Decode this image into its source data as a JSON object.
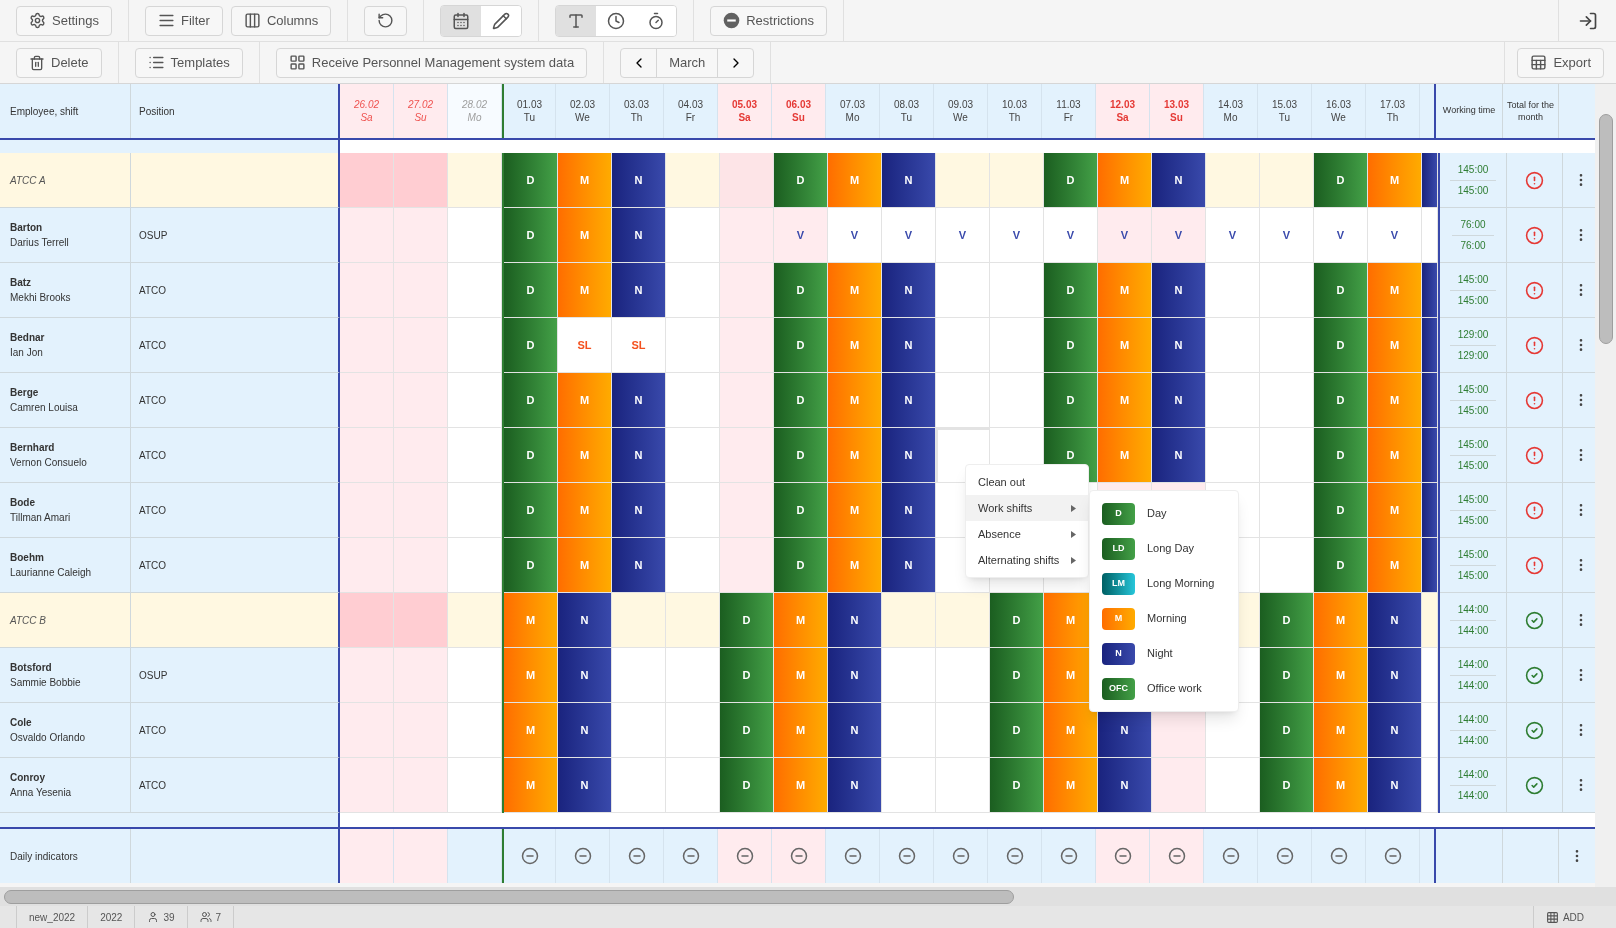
{
  "toolbar": {
    "buttons": [
      {
        "kind": "settings",
        "label": "Settings"
      },
      {
        "kind": "filter",
        "label": "Filter"
      },
      {
        "kind": "columns",
        "label": "Columns"
      },
      {
        "kind": "undo"
      }
    ],
    "view_toggle": [
      {
        "kind": "calendar",
        "selected": true
      },
      {
        "kind": "edit",
        "selected": false
      }
    ],
    "display_toggle": [
      {
        "kind": "text",
        "selected": true
      },
      {
        "kind": "clock",
        "selected": false
      },
      {
        "kind": "timer",
        "selected": false
      }
    ],
    "restrictions": "Restrictions"
  },
  "actions": {
    "delete": "Delete",
    "templates": "Templates",
    "receive": "Receive Personnel Management system data",
    "month": "March",
    "export": "Export"
  },
  "table": {
    "columns": {
      "employee": "Employee, shift",
      "position": "Position",
      "working_time": "Working time",
      "total": "Total for the month"
    },
    "days": [
      {
        "date": "26.02",
        "weekday": "Sa",
        "weekend": true,
        "previous_month": true
      },
      {
        "date": "27.02",
        "weekday": "Su",
        "weekend": true,
        "previous_month": true
      },
      {
        "date": "28.02",
        "weekday": "Mo",
        "weekend": false,
        "previous_month": true
      },
      {
        "date": "01.03",
        "weekday": "Tu",
        "weekend": false,
        "previous_month": false
      },
      {
        "date": "02.03",
        "weekday": "We",
        "weekend": false,
        "previous_month": false
      },
      {
        "date": "03.03",
        "weekday": "Th",
        "weekend": false,
        "previous_month": false
      },
      {
        "date": "04.03",
        "weekday": "Fr",
        "weekend": false,
        "previous_month": false
      },
      {
        "date": "05.03",
        "weekday": "Sa",
        "weekend": true,
        "previous_month": false
      },
      {
        "date": "06.03",
        "weekday": "Su",
        "weekend": true,
        "previous_month": false
      },
      {
        "date": "07.03",
        "weekday": "Mo",
        "weekend": false,
        "previous_month": false
      },
      {
        "date": "08.03",
        "weekday": "Tu",
        "weekend": false,
        "previous_month": false
      },
      {
        "date": "09.03",
        "weekday": "We",
        "weekend": false,
        "previous_month": false
      },
      {
        "date": "10.03",
        "weekday": "Th",
        "weekend": false,
        "previous_month": false
      },
      {
        "date": "11.03",
        "weekday": "Fr",
        "weekend": false,
        "previous_month": false
      },
      {
        "date": "12.03",
        "weekday": "Sa",
        "weekend": true,
        "previous_month": false
      },
      {
        "date": "13.03",
        "weekday": "Su",
        "weekend": true,
        "previous_month": false
      },
      {
        "date": "14.03",
        "weekday": "Mo",
        "weekend": false,
        "previous_month": false
      },
      {
        "date": "15.03",
        "weekday": "Tu",
        "weekend": false,
        "previous_month": false
      },
      {
        "date": "16.03",
        "weekday": "We",
        "weekend": false,
        "previous_month": false
      },
      {
        "date": "17.03",
        "weekday": "Th",
        "weekend": false,
        "previous_month": false
      }
    ],
    "rows": [
      {
        "kind": "group",
        "name": "ATCC A",
        "hours": [
          "145:00",
          "145:00"
        ],
        "valid": false,
        "cells": [
          null,
          null,
          null,
          {
            "t": "D",
            "kind": "day"
          },
          {
            "t": "M",
            "kind": "morning"
          },
          {
            "t": "N",
            "kind": "night"
          },
          null,
          null,
          {
            "t": "D",
            "kind": "day"
          },
          {
            "t": "M",
            "kind": "morning"
          },
          {
            "t": "N",
            "kind": "night"
          },
          null,
          null,
          {
            "t": "D",
            "kind": "day"
          },
          {
            "t": "M",
            "kind": "morning"
          },
          {
            "t": "N",
            "kind": "night"
          },
          null,
          null,
          {
            "t": "D",
            "kind": "day"
          },
          {
            "t": "M",
            "kind": "morning"
          },
          {
            "kind": "night"
          }
        ]
      },
      {
        "kind": "employee",
        "surname": "Barton",
        "given_name": "Darius Terrell",
        "position": "OSUP",
        "hours": [
          "76:00",
          "76:00"
        ],
        "valid": false,
        "cells": [
          null,
          null,
          null,
          {
            "t": "D",
            "kind": "day"
          },
          {
            "t": "M",
            "kind": "morning"
          },
          {
            "t": "N",
            "kind": "night"
          },
          null,
          null,
          {
            "t": "V",
            "kind": "vacation"
          },
          {
            "t": "V",
            "kind": "vacation"
          },
          {
            "t": "V",
            "kind": "vacation"
          },
          {
            "t": "V",
            "kind": "vacation"
          },
          {
            "t": "V",
            "kind": "vacation"
          },
          {
            "t": "V",
            "kind": "vacation"
          },
          {
            "t": "V",
            "kind": "vacation"
          },
          {
            "t": "V",
            "kind": "vacation"
          },
          {
            "t": "V",
            "kind": "vacation"
          },
          {
            "t": "V",
            "kind": "vacation"
          },
          {
            "t": "V",
            "kind": "vacation"
          },
          {
            "t": "V",
            "kind": "vacation"
          },
          null
        ]
      },
      {
        "kind": "employee",
        "surname": "Batz",
        "given_name": "Mekhi Brooks",
        "position": "ATCO",
        "hours": [
          "145:00",
          "145:00"
        ],
        "valid": false,
        "cells": [
          null,
          null,
          null,
          {
            "t": "D",
            "kind": "day"
          },
          {
            "t": "M",
            "kind": "morning"
          },
          {
            "t": "N",
            "kind": "night"
          },
          null,
          null,
          {
            "t": "D",
            "kind": "day"
          },
          {
            "t": "M",
            "kind": "morning"
          },
          {
            "t": "N",
            "kind": "night"
          },
          null,
          null,
          {
            "t": "D",
            "kind": "day"
          },
          {
            "t": "M",
            "kind": "morning"
          },
          {
            "t": "N",
            "kind": "night"
          },
          null,
          null,
          {
            "t": "D",
            "kind": "day"
          },
          {
            "t": "M",
            "kind": "morning"
          },
          {
            "kind": "night"
          }
        ]
      },
      {
        "kind": "employee",
        "surname": "Bednar",
        "given_name": "Ian Jon",
        "position": "ATCO",
        "hours": [
          "129:00",
          "129:00"
        ],
        "valid": false,
        "cells": [
          null,
          null,
          null,
          {
            "t": "D",
            "kind": "day"
          },
          {
            "t": "SL",
            "kind": "sick"
          },
          {
            "t": "SL",
            "kind": "sick"
          },
          null,
          null,
          {
            "t": "D",
            "kind": "day"
          },
          {
            "t": "M",
            "kind": "morning"
          },
          {
            "t": "N",
            "kind": "night"
          },
          null,
          null,
          {
            "t": "D",
            "kind": "day"
          },
          {
            "t": "M",
            "kind": "morning"
          },
          {
            "t": "N",
            "kind": "night"
          },
          null,
          null,
          {
            "t": "D",
            "kind": "day"
          },
          {
            "t": "M",
            "kind": "morning"
          },
          {
            "kind": "night"
          }
        ]
      },
      {
        "kind": "employee",
        "surname": "Berge",
        "given_name": "Camren Louisa",
        "position": "ATCO",
        "hours": [
          "145:00",
          "145:00"
        ],
        "valid": false,
        "cells": [
          null,
          null,
          null,
          {
            "t": "D",
            "kind": "day"
          },
          {
            "t": "M",
            "kind": "morning"
          },
          {
            "t": "N",
            "kind": "night"
          },
          null,
          null,
          {
            "t": "D",
            "kind": "day"
          },
          {
            "t": "M",
            "kind": "morning"
          },
          {
            "t": "N",
            "kind": "night"
          },
          null,
          null,
          {
            "t": "D",
            "kind": "day"
          },
          {
            "t": "M",
            "kind": "morning"
          },
          {
            "t": "N",
            "kind": "night"
          },
          null,
          null,
          {
            "t": "D",
            "kind": "day"
          },
          {
            "t": "M",
            "kind": "morning"
          },
          {
            "kind": "night"
          }
        ]
      },
      {
        "kind": "employee",
        "surname": "Bernhard",
        "given_name": "Vernon Consuelo",
        "position": "ATCO",
        "hours": [
          "145:00",
          "145:00"
        ],
        "valid": false,
        "cells": [
          null,
          null,
          null,
          {
            "t": "D",
            "kind": "day"
          },
          {
            "t": "M",
            "kind": "morning"
          },
          {
            "t": "N",
            "kind": "night"
          },
          null,
          null,
          {
            "t": "D",
            "kind": "day"
          },
          {
            "t": "M",
            "kind": "morning"
          },
          {
            "t": "N",
            "kind": "night"
          },
          {
            "kind": "selected"
          },
          null,
          {
            "t": "D",
            "kind": "day"
          },
          {
            "t": "M",
            "kind": "morning"
          },
          {
            "t": "N",
            "kind": "night"
          },
          null,
          null,
          {
            "t": "D",
            "kind": "day"
          },
          {
            "t": "M",
            "kind": "morning"
          },
          {
            "kind": "night"
          }
        ]
      },
      {
        "kind": "employee",
        "surname": "Bode",
        "given_name": "Tillman Amari",
        "position": "ATCO",
        "hours": [
          "145:00",
          "145:00"
        ],
        "valid": false,
        "cells": [
          null,
          null,
          null,
          {
            "t": "D",
            "kind": "day"
          },
          {
            "t": "M",
            "kind": "morning"
          },
          {
            "t": "N",
            "kind": "night"
          },
          null,
          null,
          {
            "t": "D",
            "kind": "day"
          },
          {
            "t": "M",
            "kind": "morning"
          },
          {
            "t": "N",
            "kind": "night"
          },
          null,
          null,
          null,
          null,
          null,
          null,
          null,
          {
            "t": "D",
            "kind": "day"
          },
          {
            "t": "M",
            "kind": "morning"
          },
          {
            "kind": "night"
          }
        ]
      },
      {
        "kind": "employee",
        "surname": "Boehm",
        "given_name": "Laurianne Caleigh",
        "position": "ATCO",
        "hours": [
          "145:00",
          "145:00"
        ],
        "valid": false,
        "cells": [
          null,
          null,
          null,
          {
            "t": "D",
            "kind": "day"
          },
          {
            "t": "M",
            "kind": "morning"
          },
          {
            "t": "N",
            "kind": "night"
          },
          null,
          null,
          {
            "t": "D",
            "kind": "day"
          },
          {
            "t": "M",
            "kind": "morning"
          },
          {
            "t": "N",
            "kind": "night"
          },
          null,
          null,
          null,
          null,
          null,
          null,
          null,
          {
            "t": "D",
            "kind": "day"
          },
          {
            "t": "M",
            "kind": "morning"
          },
          {
            "kind": "night"
          }
        ]
      },
      {
        "kind": "group",
        "name": "ATCC B",
        "hours": [
          "144:00",
          "144:00"
        ],
        "valid": true,
        "cells": [
          null,
          null,
          null,
          {
            "t": "M",
            "kind": "morning"
          },
          {
            "t": "N",
            "kind": "night"
          },
          null,
          null,
          {
            "t": "D",
            "kind": "day"
          },
          {
            "t": "M",
            "kind": "morning"
          },
          {
            "t": "N",
            "kind": "night"
          },
          null,
          null,
          {
            "t": "D",
            "kind": "day"
          },
          {
            "t": "M",
            "kind": "morning"
          },
          null,
          null,
          null,
          {
            "t": "D",
            "kind": "day"
          },
          {
            "t": "M",
            "kind": "morning"
          },
          {
            "t": "N",
            "kind": "night"
          },
          null
        ]
      },
      {
        "kind": "employee",
        "surname": "Botsford",
        "given_name": "Sammie Bobbie",
        "position": "OSUP",
        "hours": [
          "144:00",
          "144:00"
        ],
        "valid": true,
        "cells": [
          null,
          null,
          null,
          {
            "t": "M",
            "kind": "morning"
          },
          {
            "t": "N",
            "kind": "night"
          },
          null,
          null,
          {
            "t": "D",
            "kind": "day"
          },
          {
            "t": "M",
            "kind": "morning"
          },
          {
            "t": "N",
            "kind": "night"
          },
          null,
          null,
          {
            "t": "D",
            "kind": "day"
          },
          {
            "t": "M",
            "kind": "morning"
          },
          null,
          null,
          null,
          {
            "t": "D",
            "kind": "day"
          },
          {
            "t": "M",
            "kind": "morning"
          },
          {
            "t": "N",
            "kind": "night"
          },
          null
        ]
      },
      {
        "kind": "employee",
        "surname": "Cole",
        "given_name": "Osvaldo Orlando",
        "position": "ATCO",
        "hours": [
          "144:00",
          "144:00"
        ],
        "valid": true,
        "cells": [
          null,
          null,
          null,
          {
            "t": "M",
            "kind": "morning"
          },
          {
            "t": "N",
            "kind": "night"
          },
          null,
          null,
          {
            "t": "D",
            "kind": "day"
          },
          {
            "t": "M",
            "kind": "morning"
          },
          {
            "t": "N",
            "kind": "night"
          },
          null,
          null,
          {
            "t": "D",
            "kind": "day"
          },
          {
            "t": "M",
            "kind": "morning"
          },
          {
            "t": "N",
            "kind": "night"
          },
          null,
          null,
          {
            "t": "D",
            "kind": "day"
          },
          {
            "t": "M",
            "kind": "morning"
          },
          {
            "t": "N",
            "kind": "night"
          },
          null
        ]
      },
      {
        "kind": "employee",
        "surname": "Conroy",
        "given_name": "Anna Yesenia",
        "position": "ATCO",
        "hours": [
          "144:00",
          "144:00"
        ],
        "valid": true,
        "cells": [
          null,
          null,
          null,
          {
            "t": "M",
            "kind": "morning"
          },
          {
            "t": "N",
            "kind": "night"
          },
          null,
          null,
          {
            "t": "D",
            "kind": "day"
          },
          {
            "t": "M",
            "kind": "morning"
          },
          {
            "t": "N",
            "kind": "night"
          },
          null,
          null,
          {
            "t": "D",
            "kind": "day"
          },
          {
            "t": "M",
            "kind": "morning"
          },
          {
            "t": "N",
            "kind": "night"
          },
          null,
          null,
          {
            "t": "D",
            "kind": "day"
          },
          {
            "t": "M",
            "kind": "morning"
          },
          {
            "t": "N",
            "kind": "night"
          },
          null
        ]
      }
    ],
    "daily_indicators": "Daily indicators"
  },
  "context_menu": {
    "items": [
      {
        "label": "Clean out",
        "submenu": false,
        "selected": false
      },
      {
        "label": "Work shifts",
        "submenu": true,
        "selected": true
      },
      {
        "label": "Absence",
        "submenu": true,
        "selected": false
      },
      {
        "label": "Alternating shifts",
        "submenu": true,
        "selected": false
      }
    ],
    "submenu": [
      {
        "code": "D",
        "label": "Day",
        "kind": "day"
      },
      {
        "code": "LD",
        "label": "Long Day",
        "kind": "day"
      },
      {
        "code": "LM",
        "label": "Long Morning",
        "kind": "long_morning"
      },
      {
        "code": "M",
        "label": "Morning",
        "kind": "morning"
      },
      {
        "code": "N",
        "label": "Night",
        "kind": "night"
      },
      {
        "code": "OFC",
        "label": "Office work",
        "kind": "day"
      }
    ]
  },
  "status_bar": {
    "schedule": "new_2022",
    "year": "2022",
    "employees": "39",
    "groups": "7",
    "add": "ADD"
  }
}
